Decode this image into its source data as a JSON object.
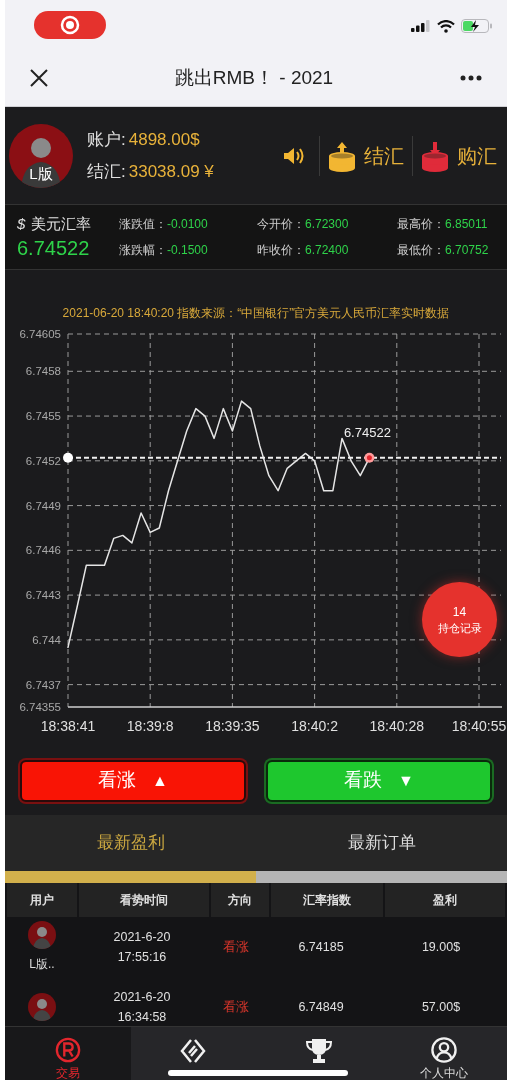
{
  "status_bar": {
    "recording": true
  },
  "nav": {
    "title": "跳出RMB！ - 2021"
  },
  "account": {
    "avatar_label": "L版",
    "balance_label": "账户:",
    "balance": "4898.00$",
    "settle_label": "结汇:",
    "settle": "33038.09 ¥",
    "actions": [
      {
        "kind": "sound"
      },
      {
        "kind": "sell",
        "label": "结汇"
      },
      {
        "kind": "buy",
        "label": "购汇"
      }
    ]
  },
  "rate": {
    "symbol": "$",
    "name": "美元汇率",
    "value": "6.74522",
    "stats": [
      {
        "label": "涨跌值：",
        "value": "-0.0100"
      },
      {
        "label": "涨跌幅：",
        "value": "-0.1500"
      },
      {
        "label": "今开价：",
        "value": "6.72300"
      },
      {
        "label": "昨收价：",
        "value": "6.72400"
      },
      {
        "label": "最高价：",
        "value": "6.85011"
      },
      {
        "label": "最低价：",
        "value": "6.70752"
      }
    ]
  },
  "chart": {
    "chart_data": {
      "type": "line",
      "title": "2021-06-20 18:40:20 指数来源：“中国银行”官方美元人民币汇率实时数据",
      "categories": [
        "18:38:41",
        null,
        null,
        null,
        null,
        null,
        null,
        null,
        null,
        "18:39:8",
        null,
        null,
        null,
        null,
        null,
        null,
        null,
        null,
        "18:39:35",
        null,
        null,
        null,
        null,
        null,
        null,
        null,
        null,
        "18:40:2",
        null,
        null,
        null,
        null,
        null,
        null,
        null,
        null,
        "18:40:28",
        null,
        null,
        null,
        null,
        null,
        null,
        null,
        null,
        "18:40:55"
      ],
      "series": [
        {
          "color": "#e5e5e5",
          "values": [
            6.74395,
            6.74422,
            6.7445,
            6.7445,
            6.7445,
            6.74468,
            6.7447,
            6.74465,
            6.74485,
            6.74472,
            6.74475,
            6.745,
            6.7452,
            6.7454,
            6.74555,
            6.7455,
            6.74535,
            6.74555,
            6.7454,
            6.7456,
            6.74555,
            6.7453,
            6.7451,
            6.745,
            6.74515,
            6.7452,
            6.74525,
            6.7452,
            6.745,
            6.745,
            6.74535,
            6.7452,
            6.7451,
            6.74522,
            null,
            null,
            null,
            null,
            null,
            null,
            null,
            null,
            null,
            null,
            null,
            null
          ]
        }
      ],
      "ylim": [
        6.74355,
        6.74605
      ],
      "yticks": [
        6.74605,
        6.7458,
        6.7455,
        6.7452,
        6.7449,
        6.7446,
        6.7443,
        6.744,
        6.7437,
        6.74355
      ],
      "grid": true,
      "ref_lines": [
        {
          "axis": "y",
          "value": 6.74522
        }
      ],
      "annotations": [
        {
          "text": "6.74522",
          "y": 6.74522
        }
      ]
    },
    "holdings": {
      "count": "14",
      "label": "持仓记录"
    }
  },
  "trade_buttons": [
    {
      "kind": "up",
      "label": "看涨",
      "arrow": "▲"
    },
    {
      "kind": "down",
      "label": "看跌",
      "arrow": "▼"
    }
  ],
  "tabs": [
    {
      "label": "最新盈利",
      "selected": true
    },
    {
      "label": "最新订单",
      "selected": false
    }
  ],
  "table": {
    "columns": [
      "用户",
      "看势时间",
      "方向",
      "汇率指数",
      "盈利"
    ],
    "rows": [
      {
        "user": "L版..",
        "date": "2021-6-20",
        "time": "17:55:16",
        "direction": "看涨",
        "kind": "up",
        "rate": "6.74185",
        "profit": "19.00$"
      },
      {
        "date": "2021-6-20",
        "time": "16:34:58",
        "direction": "看涨",
        "kind": "up",
        "rate": "6.74849",
        "profit": "57.00$"
      }
    ]
  },
  "bottom_nav": [
    {
      "kind": "trade",
      "label": "交易",
      "selected": true
    },
    {
      "kind": "market",
      "selected": false
    },
    {
      "kind": "rank",
      "selected": false
    },
    {
      "kind": "profile",
      "label": "个人中心",
      "selected": false
    }
  ]
}
